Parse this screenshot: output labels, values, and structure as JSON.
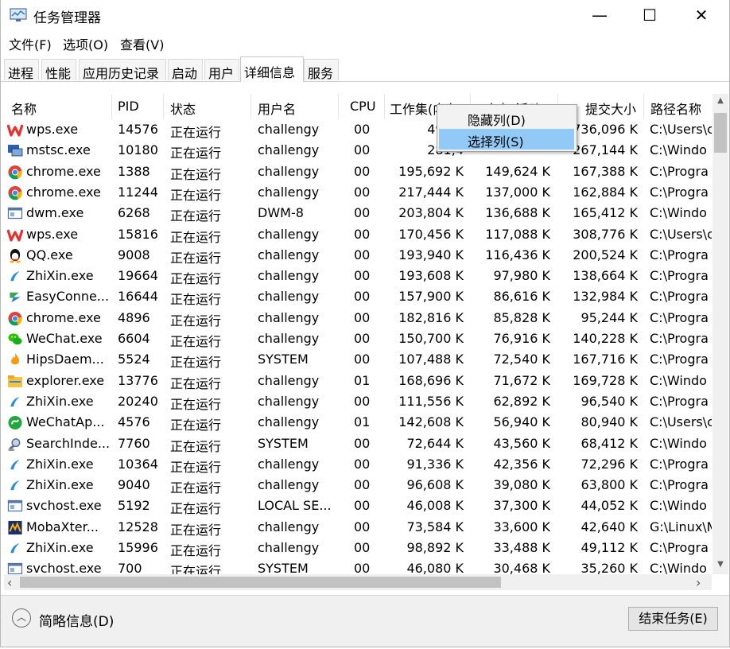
{
  "window": {
    "title": "任务管理器",
    "min": "—",
    "max": "☐",
    "close": "✕"
  },
  "menu": [
    "文件(F)",
    "选项(O)",
    "查看(V)"
  ],
  "tabs": [
    "进程",
    "性能",
    "应用历史记录",
    "启动",
    "用户",
    "详细信息",
    "服务"
  ],
  "active_tab": 5,
  "columns": [
    "名称",
    "PID",
    "状态",
    "用户名",
    "CPU",
    "工作集(内存)",
    "内存(活动...",
    "提交大小",
    "路径名称"
  ],
  "rows": [
    {
      "name": "wps.exe",
      "icon": "wps-icon",
      "pid": "14576",
      "status": "正在运行",
      "user": "challengy",
      "cpu": "00",
      "ws": "495,5",
      "mem": "",
      "commit": "736,096 K",
      "path": "C:\\Users\\c"
    },
    {
      "name": "mstsc.exe",
      "icon": "remote-desktop-icon",
      "pid": "10180",
      "status": "正在运行",
      "user": "challengy",
      "cpu": "00",
      "ws": "281,4",
      "mem": "",
      "commit": "267,144 K",
      "path": "C:\\Windo"
    },
    {
      "name": "chrome.exe",
      "icon": "chrome-icon",
      "pid": "1388",
      "status": "正在运行",
      "user": "challengy",
      "cpu": "00",
      "ws": "195,692 K",
      "mem": "149,624 K",
      "commit": "167,388 K",
      "path": "C:\\Progra"
    },
    {
      "name": "chrome.exe",
      "icon": "chrome-icon",
      "pid": "11244",
      "status": "正在运行",
      "user": "challengy",
      "cpu": "00",
      "ws": "217,444 K",
      "mem": "137,000 K",
      "commit": "162,884 K",
      "path": "C:\\Progra"
    },
    {
      "name": "dwm.exe",
      "icon": "window-icon",
      "pid": "6268",
      "status": "正在运行",
      "user": "DWM-8",
      "cpu": "00",
      "ws": "203,804 K",
      "mem": "136,688 K",
      "commit": "165,412 K",
      "path": "C:\\Windo"
    },
    {
      "name": "wps.exe",
      "icon": "wps-icon",
      "pid": "15816",
      "status": "正在运行",
      "user": "challengy",
      "cpu": "00",
      "ws": "170,456 K",
      "mem": "117,088 K",
      "commit": "308,776 K",
      "path": "C:\\Users\\c"
    },
    {
      "name": "QQ.exe",
      "icon": "qq-icon",
      "pid": "9008",
      "status": "正在运行",
      "user": "challengy",
      "cpu": "00",
      "ws": "193,940 K",
      "mem": "116,436 K",
      "commit": "200,524 K",
      "path": "C:\\Progra"
    },
    {
      "name": "ZhiXin.exe",
      "icon": "zhixin-icon",
      "pid": "19664",
      "status": "正在运行",
      "user": "challengy",
      "cpu": "00",
      "ws": "193,608 K",
      "mem": "97,980 K",
      "commit": "138,664 K",
      "path": "C:\\Progra"
    },
    {
      "name": "EasyConne...",
      "icon": "easyconnect-icon",
      "pid": "16644",
      "status": "正在运行",
      "user": "challengy",
      "cpu": "00",
      "ws": "157,900 K",
      "mem": "86,616 K",
      "commit": "132,984 K",
      "path": "C:\\Progra"
    },
    {
      "name": "chrome.exe",
      "icon": "chrome-icon",
      "pid": "4896",
      "status": "正在运行",
      "user": "challengy",
      "cpu": "00",
      "ws": "182,816 K",
      "mem": "85,828 K",
      "commit": "95,244 K",
      "path": "C:\\Progra"
    },
    {
      "name": "WeChat.exe",
      "icon": "wechat-icon",
      "pid": "6604",
      "status": "正在运行",
      "user": "challengy",
      "cpu": "00",
      "ws": "150,700 K",
      "mem": "76,916 K",
      "commit": "140,228 K",
      "path": "C:\\Progra"
    },
    {
      "name": "HipsDaem...",
      "icon": "hips-icon",
      "pid": "5524",
      "status": "正在运行",
      "user": "SYSTEM",
      "cpu": "00",
      "ws": "107,488 K",
      "mem": "72,540 K",
      "commit": "167,716 K",
      "path": "C:\\Progra"
    },
    {
      "name": "explorer.exe",
      "icon": "folder-icon",
      "pid": "13776",
      "status": "正在运行",
      "user": "challengy",
      "cpu": "01",
      "ws": "168,696 K",
      "mem": "71,672 K",
      "commit": "169,728 K",
      "path": "C:\\Windo"
    },
    {
      "name": "ZhiXin.exe",
      "icon": "zhixin-icon",
      "pid": "20240",
      "status": "正在运行",
      "user": "challengy",
      "cpu": "00",
      "ws": "111,556 K",
      "mem": "62,892 K",
      "commit": "96,540 K",
      "path": "C:\\Progra"
    },
    {
      "name": "WeChatAp...",
      "icon": "wechat-applet-icon",
      "pid": "4576",
      "status": "正在运行",
      "user": "challengy",
      "cpu": "01",
      "ws": "142,608 K",
      "mem": "56,940 K",
      "commit": "80,940 K",
      "path": "C:\\Users\\c"
    },
    {
      "name": "SearchInde...",
      "icon": "search-indexer-icon",
      "pid": "7760",
      "status": "正在运行",
      "user": "SYSTEM",
      "cpu": "00",
      "ws": "72,644 K",
      "mem": "43,560 K",
      "commit": "68,412 K",
      "path": "C:\\Windo"
    },
    {
      "name": "ZhiXin.exe",
      "icon": "zhixin-icon",
      "pid": "10364",
      "status": "正在运行",
      "user": "challengy",
      "cpu": "00",
      "ws": "91,336 K",
      "mem": "42,356 K",
      "commit": "72,296 K",
      "path": "C:\\Progra"
    },
    {
      "name": "ZhiXin.exe",
      "icon": "zhixin-icon",
      "pid": "9040",
      "status": "正在运行",
      "user": "challengy",
      "cpu": "00",
      "ws": "96,608 K",
      "mem": "39,080 K",
      "commit": "63,800 K",
      "path": "C:\\Progra"
    },
    {
      "name": "svchost.exe",
      "icon": "window-icon",
      "pid": "5192",
      "status": "正在运行",
      "user": "LOCAL SE...",
      "cpu": "00",
      "ws": "46,008 K",
      "mem": "37,300 K",
      "commit": "44,052 K",
      "path": "C:\\Windo"
    },
    {
      "name": "MobaXter...",
      "icon": "mobaxterm-icon",
      "pid": "12528",
      "status": "正在运行",
      "user": "challengy",
      "cpu": "00",
      "ws": "73,584 K",
      "mem": "33,600 K",
      "commit": "42,640 K",
      "path": "G:\\Linux\\M"
    },
    {
      "name": "ZhiXin.exe",
      "icon": "zhixin-icon",
      "pid": "15996",
      "status": "正在运行",
      "user": "challengy",
      "cpu": "00",
      "ws": "98,892 K",
      "mem": "33,488 K",
      "commit": "49,112 K",
      "path": "C:\\Progra"
    },
    {
      "name": "svchost.exe",
      "icon": "window-icon",
      "pid": "700",
      "status": "正在运行",
      "user": "SYSTEM",
      "cpu": "00",
      "ws": "46,080 K",
      "mem": "30,468 K",
      "commit": "35,260 K",
      "path": "C:\\Windo"
    }
  ],
  "context_menu": {
    "hide_column": "隐藏列(D)",
    "select_columns": "选择列(S)"
  },
  "footer": {
    "collapse_icon": "︿",
    "brief": "简略信息(D)",
    "end_task": "结束任务(E)"
  },
  "colors": {
    "menu_hover": "#91c9f7",
    "scroll_thumb": "#c2c2c2",
    "bg_bar": "#f0f0f0"
  }
}
